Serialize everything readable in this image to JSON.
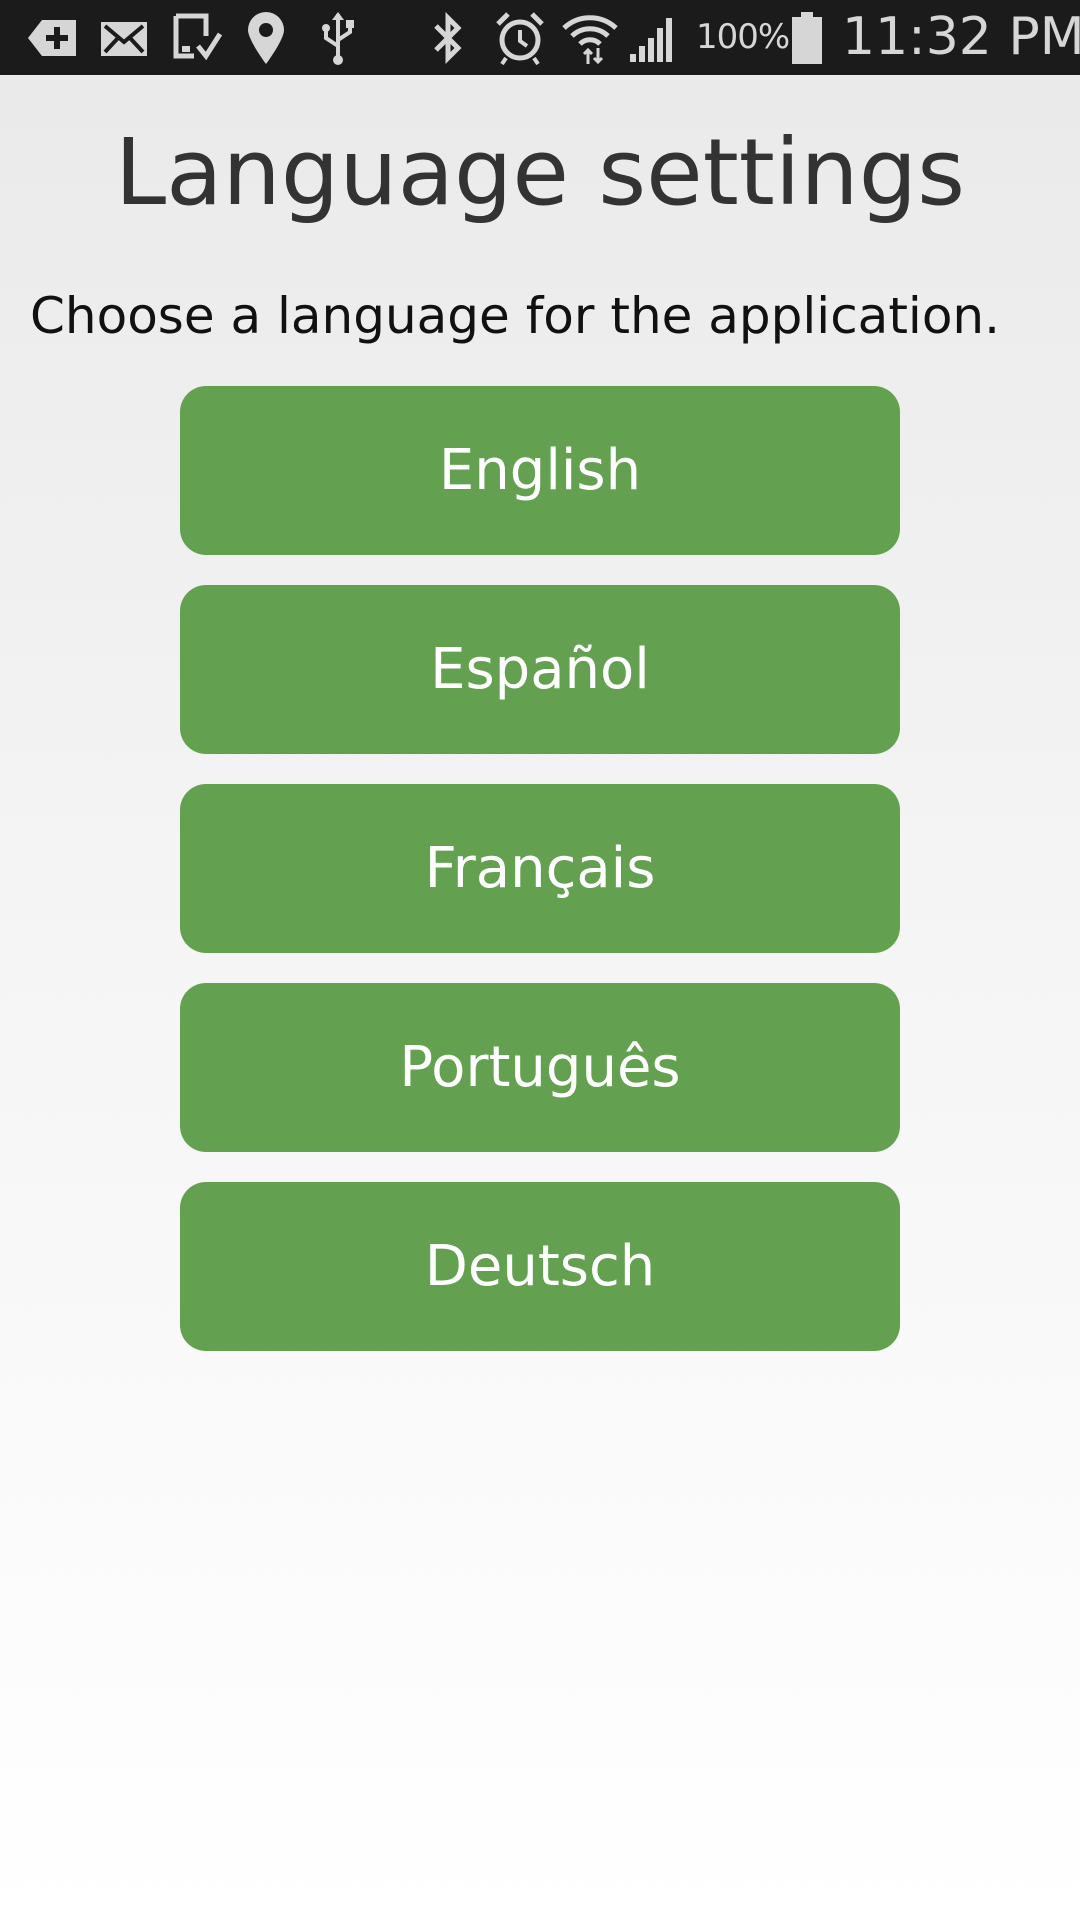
{
  "status_bar": {
    "icons": [
      "add-icon",
      "mail-icon",
      "download-icon",
      "location-icon",
      "usb-icon",
      "bluetooth-icon",
      "alarm-icon",
      "wifi-icon",
      "signal-icon",
      "battery-icon"
    ],
    "battery_percent": "100%",
    "time": "11:32 PM",
    "background_color": "#1b1b1b"
  },
  "page": {
    "title": "Language settings",
    "instruction": "Choose a language for the application."
  },
  "languages": [
    {
      "label": "English"
    },
    {
      "label": "Español"
    },
    {
      "label": "Français"
    },
    {
      "label": "Português"
    },
    {
      "label": "Deutsch"
    }
  ],
  "colors": {
    "button_color": "#63a050",
    "button_text": "#ffffff"
  }
}
